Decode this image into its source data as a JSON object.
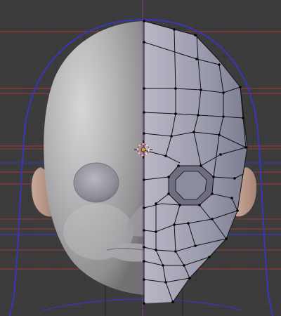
{
  "app": {
    "name": "3D Viewport"
  },
  "viewport": {
    "background_color": "#3c3c3c",
    "grid_color": "#343434",
    "guide_line_color": "#c0393b",
    "blue_guide_color": "#3a36b8",
    "center_line_color": "#8b3f9e",
    "mesh_wire_color": "#101010",
    "vertex_color": "#000000",
    "cursor_color": "#f08c2a"
  },
  "objects": {
    "sculpt": "head-sculpt",
    "mesh": "retopology-mesh",
    "cursor": "3d-cursor"
  }
}
